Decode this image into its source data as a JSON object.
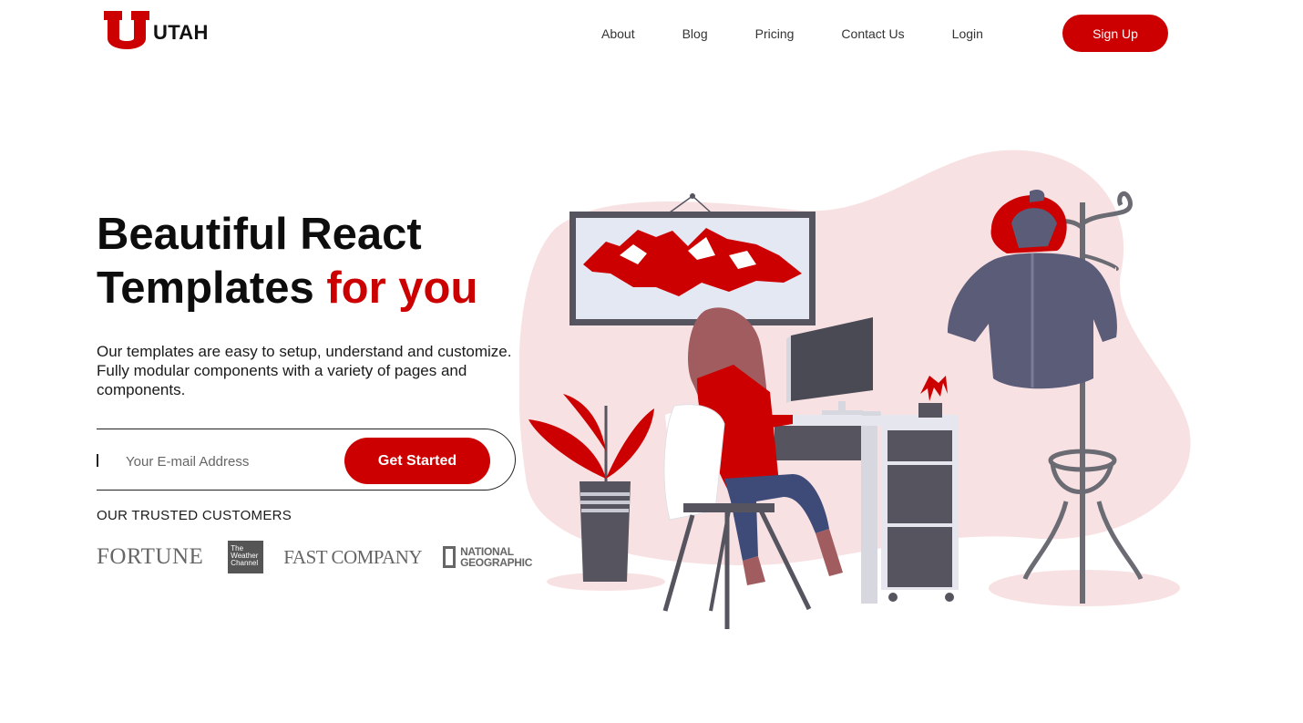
{
  "brand": {
    "name": "UTAH",
    "logo_letter": "U",
    "color": "#cc0000"
  },
  "nav": {
    "items": [
      "About",
      "Blog",
      "Pricing",
      "Contact Us",
      "Login"
    ],
    "signup": "Sign Up"
  },
  "hero": {
    "headline_line1": "Beautiful React",
    "headline_line2_plain": "Templates",
    "headline_line2_accent": "for you",
    "description": "Our templates are easy to setup, understand and customize. Fully modular components with a variety of pages and components.",
    "email_placeholder": "Your E-mail Address",
    "cta": "Get Started"
  },
  "customers": {
    "label": "OUR TRUSTED CUSTOMERS",
    "logos": {
      "fortune": "FORTUNE",
      "weather": [
        "The",
        "Weather",
        "Channel"
      ],
      "fastcompany": "FAST COMPANY",
      "natgeo": [
        "NATIONAL",
        "GEOGRAPHIC"
      ]
    }
  },
  "illustration": {
    "accent": "#cc0000",
    "dark": "#55545f",
    "blob": "#f8e1e3",
    "icons": [
      "framed-mountain-picture",
      "woman-at-desk",
      "computer-monitor",
      "potted-plant",
      "coat-rack",
      "winter-jacket"
    ]
  }
}
